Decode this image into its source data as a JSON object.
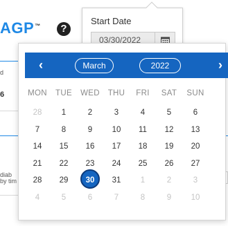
{
  "background": {
    "title": "AGP",
    "trademark": "™",
    "help_icon": "question-circle-icon",
    "left_snippets": [
      "d",
      "6",
      "diab",
      "by tim"
    ],
    "right_snippets": [
      "u",
      "w",
      "u",
      "3"
    ]
  },
  "start_date": {
    "label": "Start Date",
    "value": "03/30/2022",
    "calendar_icon": "calendar-icon"
  },
  "calendar": {
    "prev_label": "‹",
    "next_label": "›",
    "month": "March",
    "year": "2022",
    "header_color": "#1565c0",
    "weekdays": [
      "MON",
      "TUE",
      "WED",
      "THU",
      "FRI",
      "SAT",
      "SUN"
    ],
    "weeks": [
      [
        {
          "d": "28",
          "muted": true
        },
        {
          "d": "1"
        },
        {
          "d": "2"
        },
        {
          "d": "3"
        },
        {
          "d": "4"
        },
        {
          "d": "5"
        },
        {
          "d": "6"
        }
      ],
      [
        {
          "d": "7"
        },
        {
          "d": "8"
        },
        {
          "d": "9"
        },
        {
          "d": "10"
        },
        {
          "d": "11"
        },
        {
          "d": "12"
        },
        {
          "d": "13"
        }
      ],
      [
        {
          "d": "14"
        },
        {
          "d": "15"
        },
        {
          "d": "16"
        },
        {
          "d": "17"
        },
        {
          "d": "18"
        },
        {
          "d": "19"
        },
        {
          "d": "20"
        }
      ],
      [
        {
          "d": "21"
        },
        {
          "d": "22"
        },
        {
          "d": "23"
        },
        {
          "d": "24"
        },
        {
          "d": "25"
        },
        {
          "d": "26"
        },
        {
          "d": "27"
        }
      ],
      [
        {
          "d": "28"
        },
        {
          "d": "29"
        },
        {
          "d": "30",
          "selected": true
        },
        {
          "d": "31"
        },
        {
          "d": "1",
          "muted": true
        },
        {
          "d": "2",
          "muted": true
        },
        {
          "d": "3",
          "muted": true
        }
      ],
      [
        {
          "d": "4",
          "muted": true
        },
        {
          "d": "5",
          "muted": true
        },
        {
          "d": "6",
          "muted": true
        },
        {
          "d": "7",
          "muted": true
        },
        {
          "d": "8",
          "muted": true
        },
        {
          "d": "9",
          "muted": true
        },
        {
          "d": "10",
          "muted": true
        }
      ]
    ]
  }
}
